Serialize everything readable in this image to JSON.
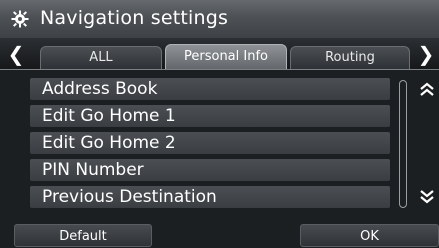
{
  "header": {
    "title": "Navigation settings",
    "icon": "gear-icon"
  },
  "tabs": [
    {
      "label": "ALL",
      "selected": false
    },
    {
      "label": "Personal Info",
      "selected": true
    },
    {
      "label": "Routing",
      "selected": false
    }
  ],
  "nav": {
    "prev_icon": "chevron-left-icon",
    "next_icon": "chevron-right-icon"
  },
  "list": {
    "items": [
      {
        "label": "Address Book"
      },
      {
        "label": "Edit Go Home 1"
      },
      {
        "label": "Edit Go Home 2"
      },
      {
        "label": "PIN Number"
      },
      {
        "label": "Previous Destination"
      }
    ]
  },
  "scroll": {
    "up_icon": "double-chevron-up-icon",
    "down_icon": "double-chevron-down-icon"
  },
  "footer": {
    "default_label": "Default",
    "ok_label": "OK"
  }
}
